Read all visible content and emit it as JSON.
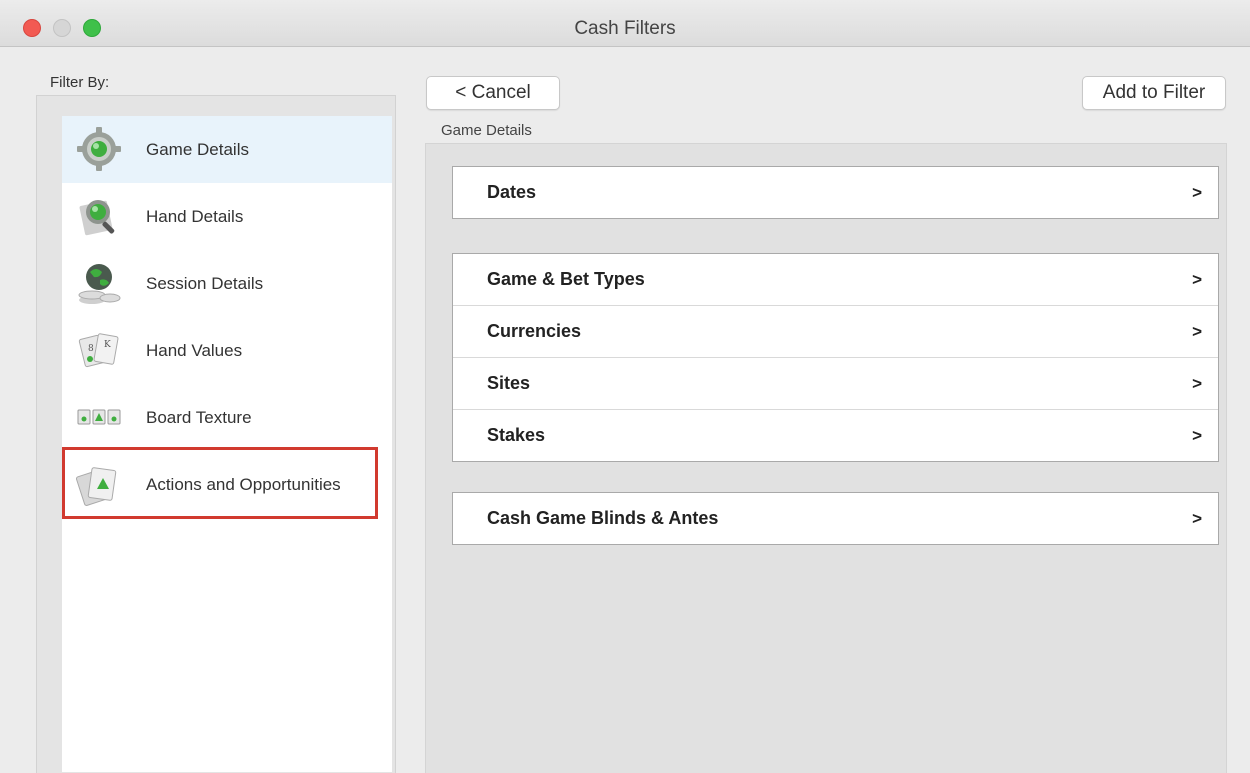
{
  "window": {
    "title": "Cash Filters"
  },
  "left": {
    "label": "Filter By:",
    "items": [
      {
        "label": "Game Details",
        "icon": "gear-icon",
        "selected": true
      },
      {
        "label": "Hand Details",
        "icon": "magnifier-icon"
      },
      {
        "label": "Session Details",
        "icon": "globe-coins-icon"
      },
      {
        "label": "Hand Values",
        "icon": "cards-icon"
      },
      {
        "label": "Board Texture",
        "icon": "board-cards-icon"
      },
      {
        "label": "Actions and Opportunities",
        "icon": "card-arrow-icon"
      }
    ]
  },
  "toolbar": {
    "cancel_label": "< Cancel",
    "add_label": "Add to Filter"
  },
  "main": {
    "caption": "Game Details",
    "groups": [
      {
        "rows": [
          {
            "label": "Dates",
            "chevron": ">"
          }
        ]
      },
      {
        "rows": [
          {
            "label": "Game & Bet Types",
            "chevron": ">"
          },
          {
            "label": "Currencies",
            "chevron": ">"
          },
          {
            "label": "Sites",
            "chevron": ">"
          },
          {
            "label": "Stakes",
            "chevron": ">"
          }
        ]
      },
      {
        "rows": [
          {
            "label": "Cash Game Blinds & Antes",
            "chevron": ">"
          }
        ]
      }
    ]
  },
  "colors": {
    "accent_green": "#3fae3f",
    "highlight_red": "#d13a2f",
    "selected_bg": "#e8f3fb"
  }
}
